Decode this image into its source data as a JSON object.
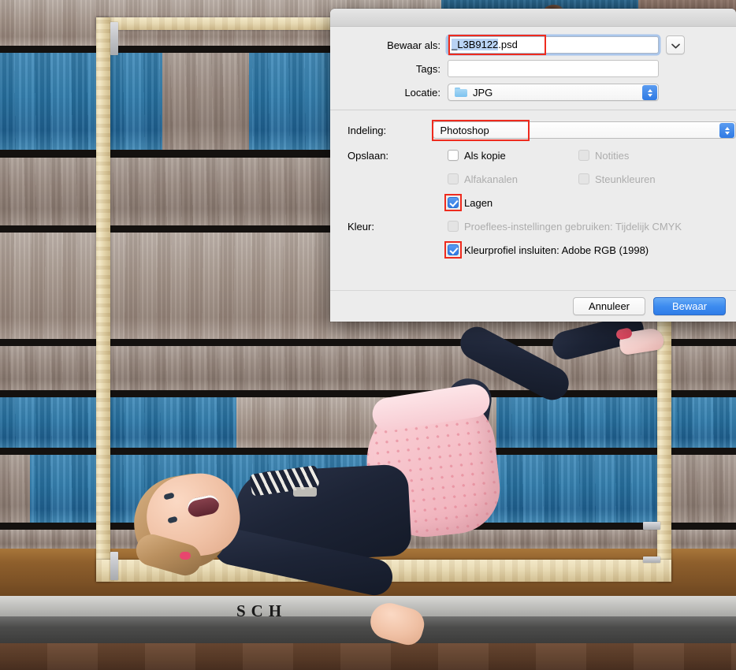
{
  "photo": {
    "description": "Girl lying inside a wooden picture frame on a bench against a weathered blue and grey plank backdrop",
    "bench_text": "SCH"
  },
  "dialog": {
    "title": "",
    "fields": {
      "save_as_label": "Bewaar als:",
      "file_name_selected": "_L3B9122",
      "file_name_extension": ".psd",
      "tags_label": "Tags:",
      "tags_value": "",
      "location_label": "Locatie:",
      "location_value": "JPG",
      "location_icon": "folder-icon",
      "expand_icon": "chevron-down-icon"
    },
    "format": {
      "label": "Indeling:",
      "value": "Photoshop",
      "stepper_icon": "up-down-stepper-icon"
    },
    "save_options": {
      "label": "Opslaan:",
      "items": [
        {
          "label": "Als kopie",
          "checked": false,
          "disabled": false,
          "highlighted": false
        },
        {
          "label": "Notities",
          "checked": false,
          "disabled": true,
          "highlighted": false
        },
        {
          "label": "Alfakanalen",
          "checked": false,
          "disabled": true,
          "highlighted": false
        },
        {
          "label": "Steunkleuren",
          "checked": false,
          "disabled": true,
          "highlighted": false
        },
        {
          "label": "Lagen",
          "checked": true,
          "disabled": false,
          "highlighted": true
        }
      ]
    },
    "color_options": {
      "label": "Kleur:",
      "items": [
        {
          "label": "Proeflees-instellingen gebruiken: Tijdelijk CMYK",
          "checked": false,
          "disabled": true,
          "highlighted": false
        },
        {
          "label": "Kleurprofiel insluiten: Adobe RGB (1998)",
          "checked": true,
          "disabled": false,
          "highlighted": true
        }
      ]
    },
    "buttons": {
      "cancel": "Annuleer",
      "save": "Bewaar"
    },
    "colors": {
      "accent_blue": "#2f7ae4",
      "annotation_red": "#ee2b1e",
      "selection_blue": "#b9d3f4",
      "dialog_bg": "#ececec"
    }
  }
}
